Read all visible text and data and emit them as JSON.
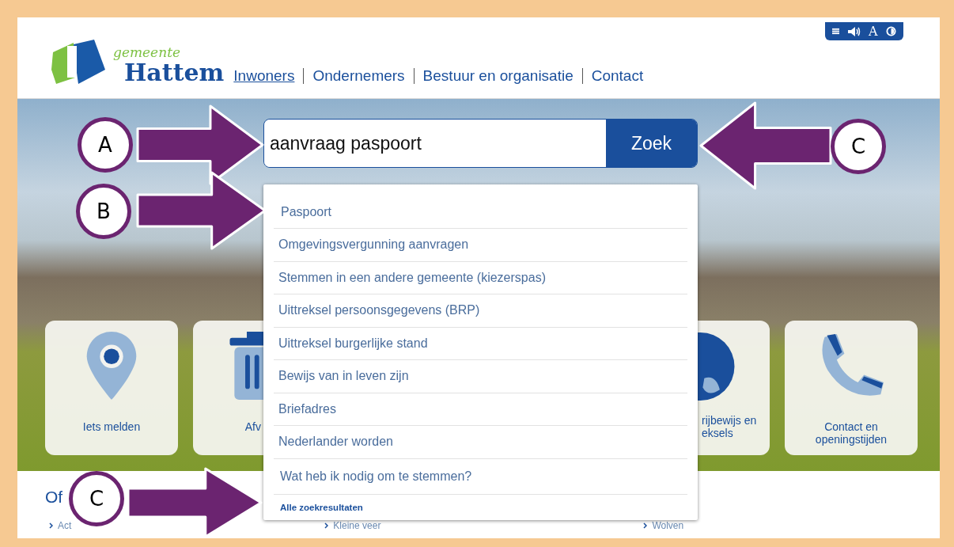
{
  "logo": {
    "small": "gemeente",
    "big": "Hattem"
  },
  "nav": [
    {
      "label": "Inwoners",
      "selected": true
    },
    {
      "label": "Ondernemers",
      "selected": false
    },
    {
      "label": "Bestuur en organisatie",
      "selected": false
    },
    {
      "label": "Contact",
      "selected": false
    }
  ],
  "toolbar": {
    "text_size_label": "A"
  },
  "search": {
    "value": "aanvraag paspoort",
    "button": "Zoek"
  },
  "suggestions": [
    "Paspoort",
    "Omgevingsvergunning aanvragen",
    "Stemmen in een andere gemeente (kiezerspas)",
    "Uittreksel persoonsgegevens (BRP)",
    "Uittreksel burgerlijke stand",
    "Bewijs van in leven zijn",
    "Briefadres",
    "Nederlander worden",
    "Wat heb ik nodig om te stemmen?"
  ],
  "all_results": "Alle zoekresultaten",
  "tiles": [
    {
      "kind": "pin",
      "label": "Iets melden"
    },
    {
      "kind": "trash",
      "label": "Afv"
    },
    {
      "kind": "globe",
      "label": "rijbewijs en\neksels"
    },
    {
      "kind": "phone",
      "label": "Contact en\nopeningstijden"
    }
  ],
  "section": {
    "heading": "Of",
    "links": [
      "Act",
      "Kleine veer",
      "Wolven"
    ]
  },
  "annotations": [
    {
      "letter": "A"
    },
    {
      "letter": "C"
    },
    {
      "letter": "B"
    },
    {
      "letter": "C"
    }
  ]
}
